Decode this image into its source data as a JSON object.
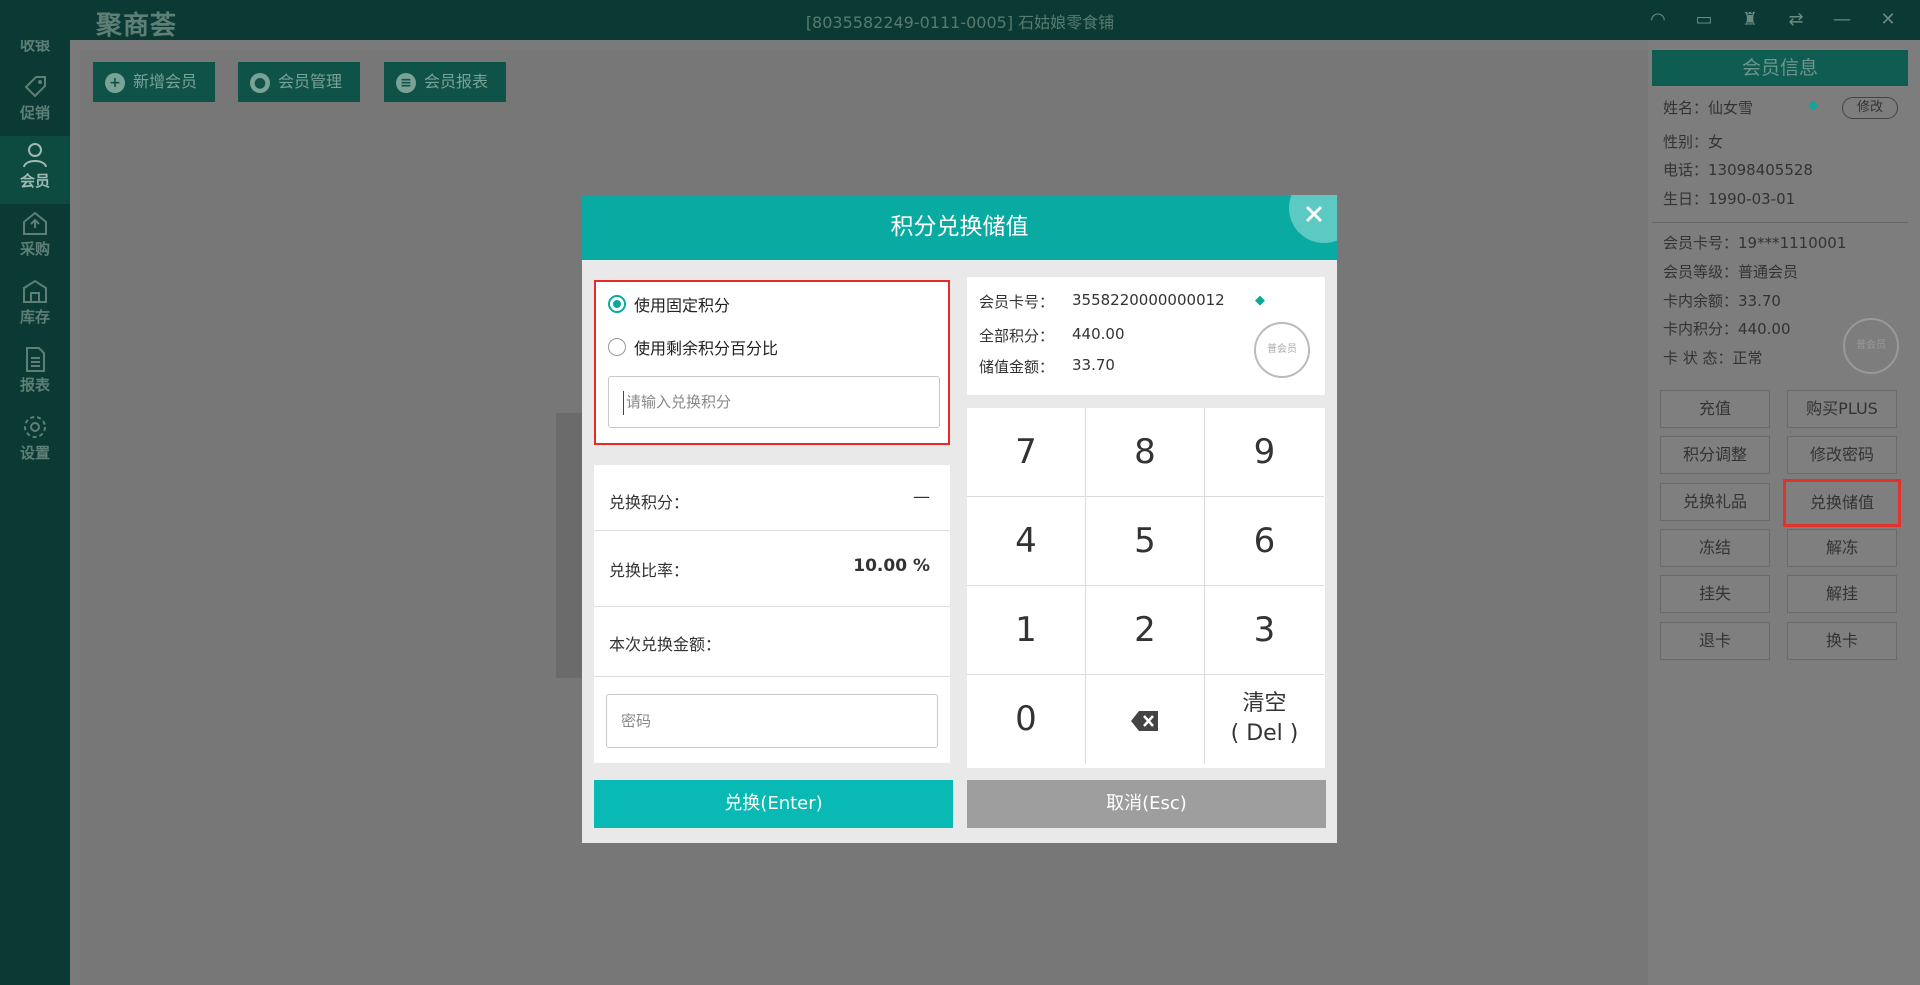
{
  "app": {
    "logo": "聚商荟",
    "store_title": "[8035582249-0111-0005] 石姑娘零食铺"
  },
  "nav": [
    {
      "label": "收银",
      "icon": "monitor-icon"
    },
    {
      "label": "促销",
      "icon": "tag-icon"
    },
    {
      "label": "会员",
      "icon": "user-icon"
    },
    {
      "label": "采购",
      "icon": "purchase-icon"
    },
    {
      "label": "库存",
      "icon": "warehouse-icon"
    },
    {
      "label": "报表",
      "icon": "report-icon"
    },
    {
      "label": "设置",
      "icon": "gear-icon"
    }
  ],
  "toolbar": {
    "add_member": "新增会员",
    "member_manage": "会员管理",
    "member_report": "会员报表"
  },
  "member_panel": {
    "title": "会员信息",
    "name": "姓名：仙女雪",
    "modify": "修改",
    "gender": "性别：女",
    "phone": "电话：13098405528",
    "birthday": "生日：1990-03-01",
    "card_no": "会员卡号：19***1110001",
    "level": "会员等级：普通会员",
    "balance": "卡内余额：33.70",
    "points": "卡内积分：440.00",
    "status": "卡 状 态：正常",
    "stamp": "普会员",
    "buttons": [
      "充值",
      "购买PLUS",
      "积分调整",
      "修改密码",
      "兑换礼品",
      "兑换储值",
      "冻结",
      "解冻",
      "挂失",
      "解挂",
      "退卡",
      "换卡"
    ]
  },
  "dialog": {
    "title": "积分兑换储值",
    "option_fixed": "使用固定积分",
    "option_percent": "使用剩余积分百分比",
    "points_placeholder": "请输入兑换积分",
    "exchange_points_label": "兑换积分：",
    "exchange_points_value": "—",
    "exchange_rate_label": "兑换比率：",
    "exchange_rate_value": "10.00 %",
    "exchange_amount_label": "本次兑换金额：",
    "password_placeholder": "密码",
    "card_no_label": "会员卡号：",
    "card_no_value": "3558220000000012",
    "total_points_label": "全部积分：",
    "total_points_value": "440.00",
    "stored_amount_label": "储值金额：",
    "stored_amount_value": "33.70",
    "stamp": "普会员",
    "keys": [
      "7",
      "8",
      "9",
      "4",
      "5",
      "6",
      "1",
      "2",
      "3",
      "0"
    ],
    "clear_key": "清空",
    "clear_key_sub": "( Del )",
    "confirm": "兑换(Enter)",
    "cancel": "取消(Esc)"
  },
  "colors": {
    "teal": "#08aaa2",
    "highlight_red": "#e52a2a"
  }
}
